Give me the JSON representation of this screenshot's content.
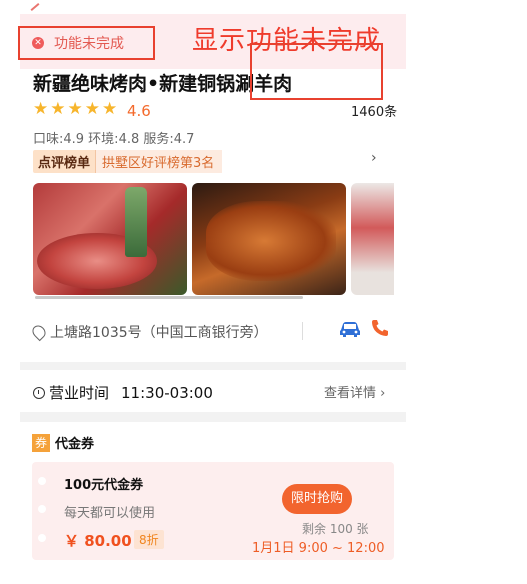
{
  "notice": {
    "label": "功能未完成",
    "annotation": "显示功能未完成"
  },
  "shop": {
    "name": "新疆绝味烤肉•新建铜锅涮羊肉",
    "rating": "4.6",
    "review_count": "1460条",
    "sub_scores": "口味:4.9 环境:4.8 服务:4.7",
    "rank_badge": "点评榜单",
    "rank_text": "拱墅区好评榜第3名",
    "address": "上塘路1035号（中国工商银行旁）"
  },
  "hours": {
    "label": "营业时间",
    "time": "11:30-03:00",
    "detail": "查看详情 ›"
  },
  "coupon": {
    "section_title": "代金券",
    "tag": "券",
    "title": "100元代金券",
    "desc": "每天都可以使用",
    "price": "￥ 80.00",
    "discount": "8折",
    "buy_label": "限时抢购",
    "remaining": "剩余 100 张",
    "time_window": "1月1日 9:00 ~ 12:00"
  },
  "icons": {
    "close": "close-circle-icon",
    "star": "star-icon",
    "chevron": "chevron-right-icon",
    "location": "location-pin-icon",
    "car": "car-icon",
    "phone": "phone-icon",
    "clock": "clock-icon"
  },
  "colors": {
    "accent": "#f2642e",
    "rating": "#f7b52c",
    "annotation": "#ef3b2c",
    "notice_bg": "#fdecee"
  }
}
